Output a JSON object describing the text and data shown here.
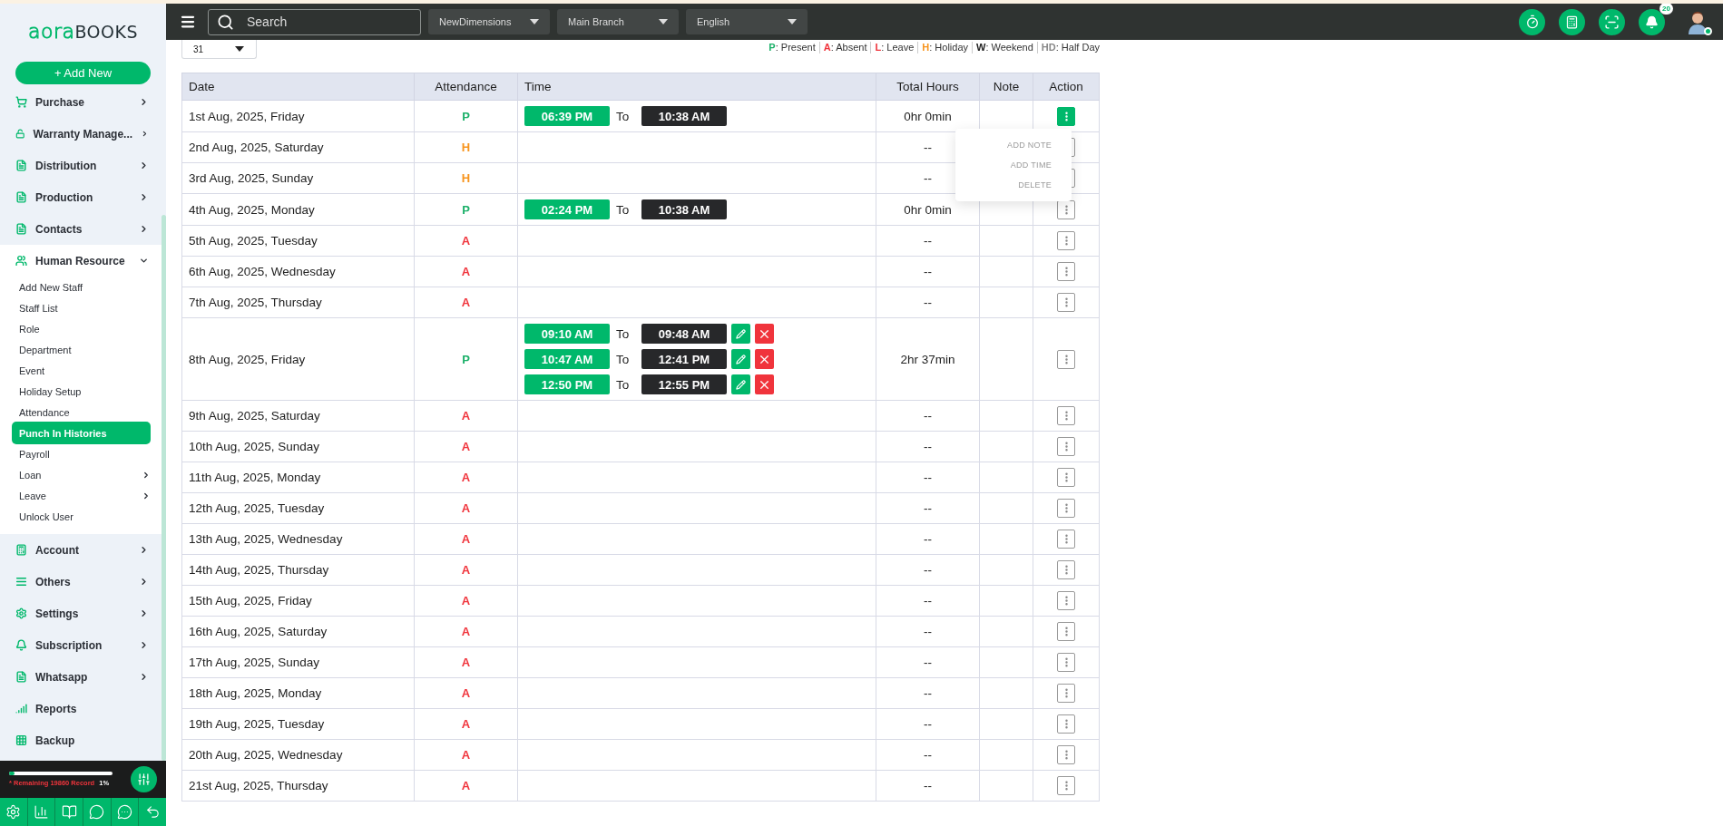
{
  "sidebar": {
    "logo": {
      "light": "aora",
      "dark": "BOOKS"
    },
    "add_button": "+ Add New",
    "menu": [
      {
        "label": "Purchase",
        "has_submenu": true,
        "expanded": false
      },
      {
        "label": "Warranty Manage...",
        "has_submenu": true,
        "expanded": false
      },
      {
        "label": "Distribution",
        "has_submenu": true,
        "expanded": false
      },
      {
        "label": "Production",
        "has_submenu": true,
        "expanded": false
      },
      {
        "label": "Contacts",
        "has_submenu": true,
        "expanded": false
      },
      {
        "label": "Human Resource",
        "has_submenu": true,
        "expanded": true,
        "children": [
          {
            "label": "Add New Staff",
            "selected": false,
            "has_submenu": false
          },
          {
            "label": "Staff List",
            "selected": false,
            "has_submenu": false
          },
          {
            "label": "Role",
            "selected": false,
            "has_submenu": false
          },
          {
            "label": "Department",
            "selected": false,
            "has_submenu": false
          },
          {
            "label": "Event",
            "selected": false,
            "has_submenu": false
          },
          {
            "label": "Holiday Setup",
            "selected": false,
            "has_submenu": false
          },
          {
            "label": "Attendance",
            "selected": false,
            "has_submenu": false
          },
          {
            "label": "Punch In Histories",
            "selected": true,
            "has_submenu": false
          },
          {
            "label": "Payroll",
            "selected": false,
            "has_submenu": false
          },
          {
            "label": "Loan",
            "selected": false,
            "has_submenu": true
          },
          {
            "label": "Leave",
            "selected": false,
            "has_submenu": true
          },
          {
            "label": "Unlock User",
            "selected": false,
            "has_submenu": false
          }
        ]
      },
      {
        "label": "Account",
        "has_submenu": true,
        "expanded": false
      },
      {
        "label": "Others",
        "has_submenu": true,
        "expanded": false
      },
      {
        "label": "Settings",
        "has_submenu": true,
        "expanded": false
      },
      {
        "label": "Subscription",
        "has_submenu": true,
        "expanded": false
      },
      {
        "label": "Whatsapp",
        "has_submenu": true,
        "expanded": false
      },
      {
        "label": "Reports",
        "has_submenu": false,
        "expanded": false
      },
      {
        "label": "Backup",
        "has_submenu": false,
        "expanded": false
      }
    ],
    "storage": {
      "text": "* Remaining 19860 Record",
      "percent": "1%",
      "level": 0.01
    }
  },
  "topbar": {
    "search": {
      "placeholder": "Search"
    },
    "dropdowns": [
      "NewDimensions",
      "Main Branch",
      "English"
    ],
    "notification_count": "20"
  },
  "day_select": "31",
  "legend": [
    {
      "code": "P",
      "text": ": Present",
      "color": "#1db16a"
    },
    {
      "code": "A",
      "text": ": Absent",
      "color": "#f0343c"
    },
    {
      "code": "L",
      "text": ": Leave",
      "color": "#f0343c"
    },
    {
      "code": "H",
      "text": ": Holiday",
      "color": "#f7941d"
    },
    {
      "code": "W",
      "text": ": Weekend",
      "color": "#222222"
    },
    {
      "code": "HD",
      "text": ": Half Day",
      "color": "#888888"
    }
  ],
  "table": {
    "columns": [
      "Date",
      "Attendance",
      "Time",
      "Total Hours",
      "Note",
      "Action"
    ],
    "action_menu": [
      "ADD NOTE",
      "ADD TIME",
      "DELETE"
    ],
    "rows": [
      {
        "date": "1st Aug, 2025, Friday",
        "attendance": {
          "code": "P",
          "color": "#1db16a"
        },
        "entries": [
          {
            "in": "06:39 PM",
            "to": "To",
            "out": "10:38 AM",
            "editable": false
          }
        ],
        "total": "0hr 0min",
        "menu_open": true
      },
      {
        "date": "2nd Aug, 2025, Saturday",
        "attendance": {
          "code": "H",
          "color": "#f7941d"
        },
        "total": "--",
        "menu_open": false
      },
      {
        "date": "3rd Aug, 2025, Sunday",
        "attendance": {
          "code": "H",
          "color": "#f7941d"
        },
        "total": "--",
        "menu_open": false
      },
      {
        "date": "4th Aug, 2025, Monday",
        "attendance": {
          "code": "P",
          "color": "#1db16a"
        },
        "entries": [
          {
            "in": "02:24 PM",
            "to": "To",
            "out": "10:38 AM",
            "editable": false
          }
        ],
        "total": "0hr 0min",
        "menu_open": false
      },
      {
        "date": "5th Aug, 2025, Tuesday",
        "attendance": {
          "code": "A",
          "color": "#f0343c"
        },
        "total": "--",
        "menu_open": false
      },
      {
        "date": "6th Aug, 2025, Wednesday",
        "attendance": {
          "code": "A",
          "color": "#f0343c"
        },
        "total": "--",
        "menu_open": false
      },
      {
        "date": "7th Aug, 2025, Thursday",
        "attendance": {
          "code": "A",
          "color": "#f0343c"
        },
        "total": "--",
        "menu_open": false
      },
      {
        "date": "8th Aug, 2025, Friday",
        "attendance": {
          "code": "P",
          "color": "#1db16a"
        },
        "entries": [
          {
            "in": "09:10 AM",
            "to": "To",
            "out": "09:48 AM",
            "editable": true
          },
          {
            "in": "10:47 AM",
            "to": "To",
            "out": "12:41 PM",
            "editable": true
          },
          {
            "in": "12:50 PM",
            "to": "To",
            "out": "12:55 PM",
            "editable": true
          }
        ],
        "total": "2hr 37min",
        "menu_open": false
      },
      {
        "date": "9th Aug, 2025, Saturday",
        "attendance": {
          "code": "A",
          "color": "#f0343c"
        },
        "total": "--",
        "menu_open": false
      },
      {
        "date": "10th Aug, 2025, Sunday",
        "attendance": {
          "code": "A",
          "color": "#f0343c"
        },
        "total": "--",
        "menu_open": false
      },
      {
        "date": "11th Aug, 2025, Monday",
        "attendance": {
          "code": "A",
          "color": "#f0343c"
        },
        "total": "--",
        "menu_open": false
      },
      {
        "date": "12th Aug, 2025, Tuesday",
        "attendance": {
          "code": "A",
          "color": "#f0343c"
        },
        "total": "--",
        "menu_open": false
      },
      {
        "date": "13th Aug, 2025, Wednesday",
        "attendance": {
          "code": "A",
          "color": "#f0343c"
        },
        "total": "--",
        "menu_open": false
      },
      {
        "date": "14th Aug, 2025, Thursday",
        "attendance": {
          "code": "A",
          "color": "#f0343c"
        },
        "total": "--",
        "menu_open": false
      },
      {
        "date": "15th Aug, 2025, Friday",
        "attendance": {
          "code": "A",
          "color": "#f0343c"
        },
        "total": "--",
        "menu_open": false
      },
      {
        "date": "16th Aug, 2025, Saturday",
        "attendance": {
          "code": "A",
          "color": "#f0343c"
        },
        "total": "--",
        "menu_open": false
      },
      {
        "date": "17th Aug, 2025, Sunday",
        "attendance": {
          "code": "A",
          "color": "#f0343c"
        },
        "total": "--",
        "menu_open": false
      },
      {
        "date": "18th Aug, 2025, Monday",
        "attendance": {
          "code": "A",
          "color": "#f0343c"
        },
        "total": "--",
        "menu_open": false
      },
      {
        "date": "19th Aug, 2025, Tuesday",
        "attendance": {
          "code": "A",
          "color": "#f0343c"
        },
        "total": "--",
        "menu_open": false
      },
      {
        "date": "20th Aug, 2025, Wednesday",
        "attendance": {
          "code": "A",
          "color": "#f0343c"
        },
        "total": "--",
        "menu_open": false
      },
      {
        "date": "21st Aug, 2025, Thursday",
        "attendance": {
          "code": "A",
          "color": "#f0343c"
        },
        "total": "--",
        "menu_open": false
      }
    ]
  }
}
